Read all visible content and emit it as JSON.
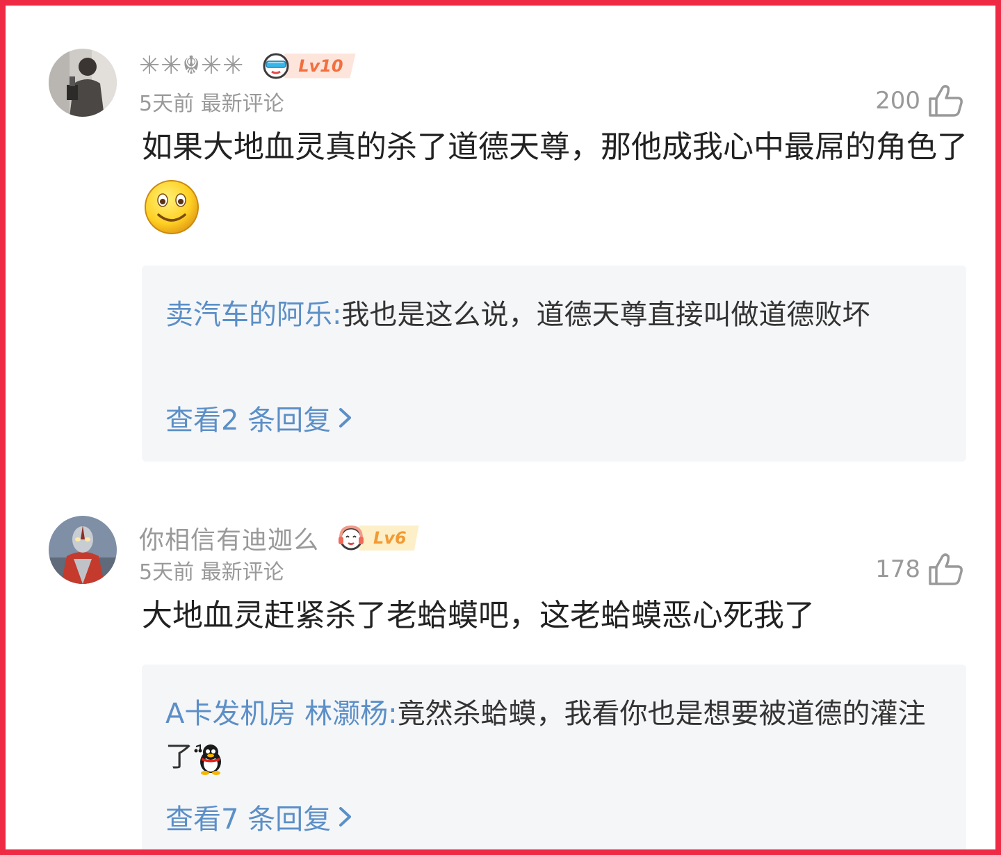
{
  "colors": {
    "frame": "#ee2a45",
    "link": "#5b8fc7",
    "muted": "#999999",
    "reply_bg": "#f5f6f8"
  },
  "comments": [
    {
      "username": "✳✳☬✳✳",
      "level": "Lv10",
      "level_icon": "sunglasses-face-icon",
      "level_color": "#f26f3f",
      "time": "5天前",
      "tag": "最新评论",
      "likes": "200",
      "content": "如果大地血灵真的杀了道德天尊，那他成我心中最屌的角色了",
      "content_emoji": "smile-emoji-icon",
      "reply": {
        "author": "卖汽车的阿乐:",
        "text": "我也是这么说，道德天尊直接叫做道德败坏",
        "more": "查看2 条回复"
      }
    },
    {
      "username": "你相信有迪迦么",
      "level": "Lv6",
      "level_icon": "headphone-face-icon",
      "level_color": "#f29a33",
      "time": "5天前",
      "tag": "最新评论",
      "likes": "178",
      "content": "大地血灵赶紧杀了老蛤蟆吧，这老蛤蟆恶心死我了",
      "reply": {
        "author": "A卡发机房 林灏杨:",
        "text": "竟然杀蛤蟆，我看你也是想要被道德的灌注了",
        "emoji": "penguin-emoji-icon",
        "more": "查看7 条回复"
      }
    }
  ]
}
